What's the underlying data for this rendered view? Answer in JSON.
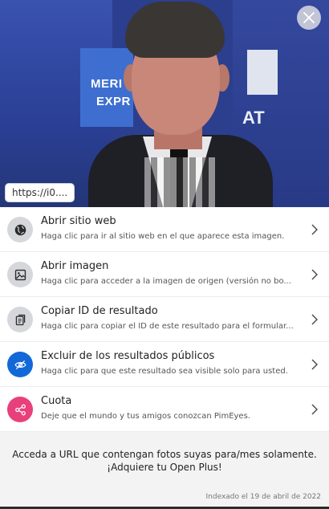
{
  "preview": {
    "url_chip": "https://i0....",
    "close_icon": "close-icon",
    "image_banner_texts": [
      "MERI",
      "EXPR",
      "AT"
    ]
  },
  "actions": [
    {
      "icon": "globe-icon",
      "title": "Abrir sitio web",
      "description": "Haga clic para ir al sitio web en el que aparece esta imagen."
    },
    {
      "icon": "image-icon",
      "title": "Abrir imagen",
      "description": "Haga clic para acceder a la imagen de origen (versión no bo..."
    },
    {
      "icon": "document-copy-icon",
      "title": "Copiar ID de resultado",
      "description": "Haga clic para copiar el ID de este resultado para el formular..."
    },
    {
      "icon": "eye-slash-icon",
      "title": "Excluir de los resultados públicos",
      "description": "Haga clic para que este resultado sea visible solo para usted."
    },
    {
      "icon": "share-icon",
      "title": "Cuota",
      "description": "Deje que el mundo y tus amigos conozcan PimEyes."
    }
  ],
  "promo": {
    "line1": "Acceda a URL que contengan fotos suyas para/mes solamente.",
    "line2": "¡Adquiere tu Open Plus!"
  },
  "indexed": "Indexado el 19 de abril de 2022",
  "colors": {
    "blue_icon": "#1368d8",
    "pink_icon": "#e8407b",
    "gray_icon": "#d6d7da"
  }
}
